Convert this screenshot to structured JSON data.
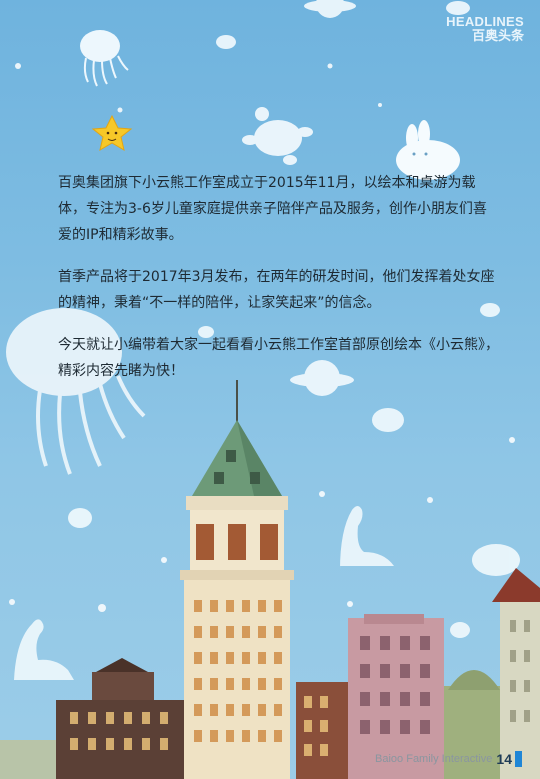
{
  "header": {
    "title_en": "HEADLINES",
    "title_zh": "百奥头条"
  },
  "article": {
    "paragraphs": [
      "百奥集团旗下小云熊工作室成立于2015年11月，以绘本和桌游为载体，专注为3-6岁儿童家庭提供亲子陪伴产品及服务，创作小朋友们喜爱的IP和精彩故事。",
      "首季产品将于2017年3月发布，在两年的研发时间，他们发挥着处女座的精神，秉着“不一样的陪伴，让家笑起来”的信念。",
      "今天就让小编带着大家一起看看小云熊工作室首部原创绘本《小云熊》，精彩内容先睹为快！"
    ]
  },
  "footer": {
    "brand": "Baioo Family Interactive",
    "page_number": "14"
  },
  "colors": {
    "sky": "#7fbde2",
    "accent": "#1f86d6"
  }
}
